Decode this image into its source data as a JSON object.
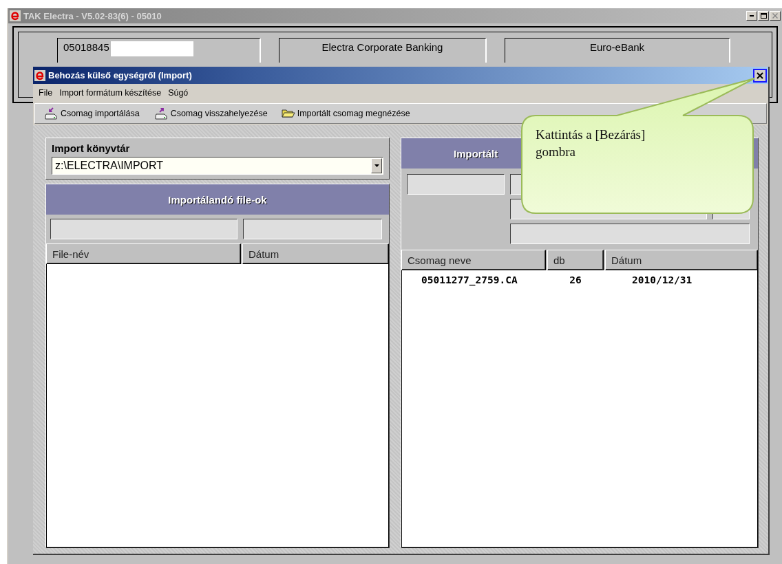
{
  "app_window": {
    "title": "TAK Electra - V5.02-83(6) - 05010",
    "fields": [
      {
        "value": "05018845",
        "redacted": true
      },
      {
        "value": "Electra Corporate Banking",
        "redacted": false
      },
      {
        "value": "Euro-eBank",
        "redacted": false
      }
    ]
  },
  "dialog": {
    "title": "Behozás külső egységről (Import)",
    "menu": [
      "File",
      "Import formátum készítése",
      "Súgó"
    ],
    "toolbar": [
      {
        "label": "Csomag importálása",
        "kind": "import"
      },
      {
        "label": "Csomag visszahelyezése",
        "kind": "restore"
      },
      {
        "label": "Importált csomag megnézése",
        "kind": "view"
      }
    ],
    "import_directory": {
      "label": "Import könyvtár",
      "value": "z:\\ELECTRA\\IMPORT"
    },
    "files_panel": {
      "title": "Importálandó file-ok",
      "columns": [
        "File-név",
        "Dátum"
      ]
    },
    "packages_panel": {
      "title": "Importált",
      "columns": [
        "Csomag neve",
        "db",
        "Dátum"
      ],
      "rows": [
        [
          "05011277_2759.CA",
          "26",
          "2010/12/31"
        ]
      ]
    }
  },
  "callout": {
    "text": "Kattintás a [Bezárás] gombra"
  }
}
